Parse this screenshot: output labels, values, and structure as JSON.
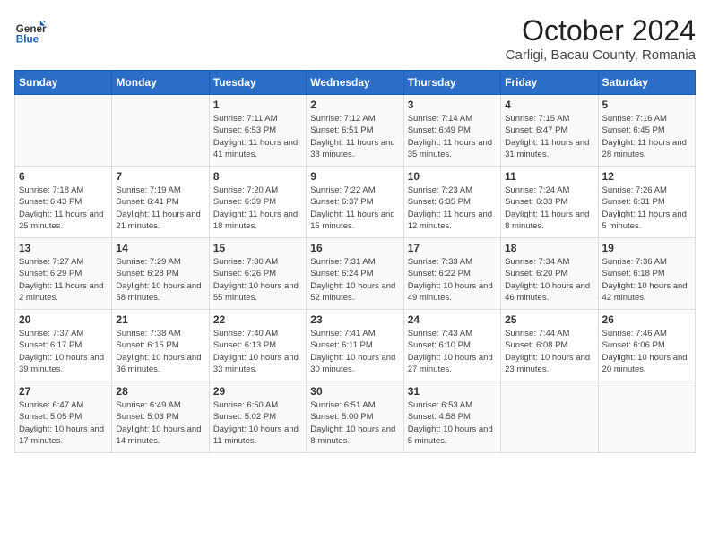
{
  "logo": {
    "general": "General",
    "blue": "Blue"
  },
  "title": "October 2024",
  "location": "Carligi, Bacau County, Romania",
  "days_of_week": [
    "Sunday",
    "Monday",
    "Tuesday",
    "Wednesday",
    "Thursday",
    "Friday",
    "Saturday"
  ],
  "weeks": [
    [
      {
        "day": "",
        "info": ""
      },
      {
        "day": "",
        "info": ""
      },
      {
        "day": "1",
        "info": "Sunrise: 7:11 AM\nSunset: 6:53 PM\nDaylight: 11 hours and 41 minutes."
      },
      {
        "day": "2",
        "info": "Sunrise: 7:12 AM\nSunset: 6:51 PM\nDaylight: 11 hours and 38 minutes."
      },
      {
        "day": "3",
        "info": "Sunrise: 7:14 AM\nSunset: 6:49 PM\nDaylight: 11 hours and 35 minutes."
      },
      {
        "day": "4",
        "info": "Sunrise: 7:15 AM\nSunset: 6:47 PM\nDaylight: 11 hours and 31 minutes."
      },
      {
        "day": "5",
        "info": "Sunrise: 7:16 AM\nSunset: 6:45 PM\nDaylight: 11 hours and 28 minutes."
      }
    ],
    [
      {
        "day": "6",
        "info": "Sunrise: 7:18 AM\nSunset: 6:43 PM\nDaylight: 11 hours and 25 minutes."
      },
      {
        "day": "7",
        "info": "Sunrise: 7:19 AM\nSunset: 6:41 PM\nDaylight: 11 hours and 21 minutes."
      },
      {
        "day": "8",
        "info": "Sunrise: 7:20 AM\nSunset: 6:39 PM\nDaylight: 11 hours and 18 minutes."
      },
      {
        "day": "9",
        "info": "Sunrise: 7:22 AM\nSunset: 6:37 PM\nDaylight: 11 hours and 15 minutes."
      },
      {
        "day": "10",
        "info": "Sunrise: 7:23 AM\nSunset: 6:35 PM\nDaylight: 11 hours and 12 minutes."
      },
      {
        "day": "11",
        "info": "Sunrise: 7:24 AM\nSunset: 6:33 PM\nDaylight: 11 hours and 8 minutes."
      },
      {
        "day": "12",
        "info": "Sunrise: 7:26 AM\nSunset: 6:31 PM\nDaylight: 11 hours and 5 minutes."
      }
    ],
    [
      {
        "day": "13",
        "info": "Sunrise: 7:27 AM\nSunset: 6:29 PM\nDaylight: 11 hours and 2 minutes."
      },
      {
        "day": "14",
        "info": "Sunrise: 7:29 AM\nSunset: 6:28 PM\nDaylight: 10 hours and 58 minutes."
      },
      {
        "day": "15",
        "info": "Sunrise: 7:30 AM\nSunset: 6:26 PM\nDaylight: 10 hours and 55 minutes."
      },
      {
        "day": "16",
        "info": "Sunrise: 7:31 AM\nSunset: 6:24 PM\nDaylight: 10 hours and 52 minutes."
      },
      {
        "day": "17",
        "info": "Sunrise: 7:33 AM\nSunset: 6:22 PM\nDaylight: 10 hours and 49 minutes."
      },
      {
        "day": "18",
        "info": "Sunrise: 7:34 AM\nSunset: 6:20 PM\nDaylight: 10 hours and 46 minutes."
      },
      {
        "day": "19",
        "info": "Sunrise: 7:36 AM\nSunset: 6:18 PM\nDaylight: 10 hours and 42 minutes."
      }
    ],
    [
      {
        "day": "20",
        "info": "Sunrise: 7:37 AM\nSunset: 6:17 PM\nDaylight: 10 hours and 39 minutes."
      },
      {
        "day": "21",
        "info": "Sunrise: 7:38 AM\nSunset: 6:15 PM\nDaylight: 10 hours and 36 minutes."
      },
      {
        "day": "22",
        "info": "Sunrise: 7:40 AM\nSunset: 6:13 PM\nDaylight: 10 hours and 33 minutes."
      },
      {
        "day": "23",
        "info": "Sunrise: 7:41 AM\nSunset: 6:11 PM\nDaylight: 10 hours and 30 minutes."
      },
      {
        "day": "24",
        "info": "Sunrise: 7:43 AM\nSunset: 6:10 PM\nDaylight: 10 hours and 27 minutes."
      },
      {
        "day": "25",
        "info": "Sunrise: 7:44 AM\nSunset: 6:08 PM\nDaylight: 10 hours and 23 minutes."
      },
      {
        "day": "26",
        "info": "Sunrise: 7:46 AM\nSunset: 6:06 PM\nDaylight: 10 hours and 20 minutes."
      }
    ],
    [
      {
        "day": "27",
        "info": "Sunrise: 6:47 AM\nSunset: 5:05 PM\nDaylight: 10 hours and 17 minutes."
      },
      {
        "day": "28",
        "info": "Sunrise: 6:49 AM\nSunset: 5:03 PM\nDaylight: 10 hours and 14 minutes."
      },
      {
        "day": "29",
        "info": "Sunrise: 6:50 AM\nSunset: 5:02 PM\nDaylight: 10 hours and 11 minutes."
      },
      {
        "day": "30",
        "info": "Sunrise: 6:51 AM\nSunset: 5:00 PM\nDaylight: 10 hours and 8 minutes."
      },
      {
        "day": "31",
        "info": "Sunrise: 6:53 AM\nSunset: 4:58 PM\nDaylight: 10 hours and 5 minutes."
      },
      {
        "day": "",
        "info": ""
      },
      {
        "day": "",
        "info": ""
      }
    ]
  ]
}
